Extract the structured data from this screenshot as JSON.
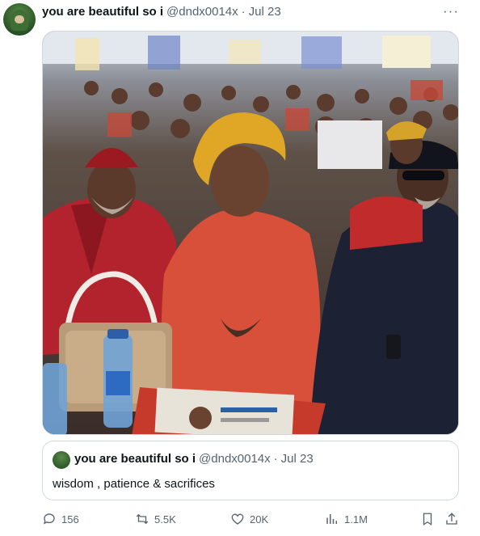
{
  "tweet": {
    "author_name": "you are beautiful so i",
    "handle": "@dndx0014x",
    "separator": "·",
    "date": "Jul 23",
    "more_icon": "more-icon",
    "more_label": "···"
  },
  "quoted": {
    "author_name": "you are beautiful so i",
    "handle": "@dndx0014x",
    "separator": "·",
    "date": "Jul 23",
    "text": "wisdom , patience & sacrifices"
  },
  "actions": {
    "reply_count": "156",
    "retweet_count": "5.5K",
    "like_count": "20K",
    "view_count": "1.1M"
  },
  "icons": [
    "reply-icon",
    "retweet-icon",
    "like-icon",
    "views-icon",
    "bookmark-icon",
    "share-icon"
  ],
  "colors": {
    "text": "#0f1419",
    "secondary": "#536471",
    "border": "#cfd9de"
  }
}
